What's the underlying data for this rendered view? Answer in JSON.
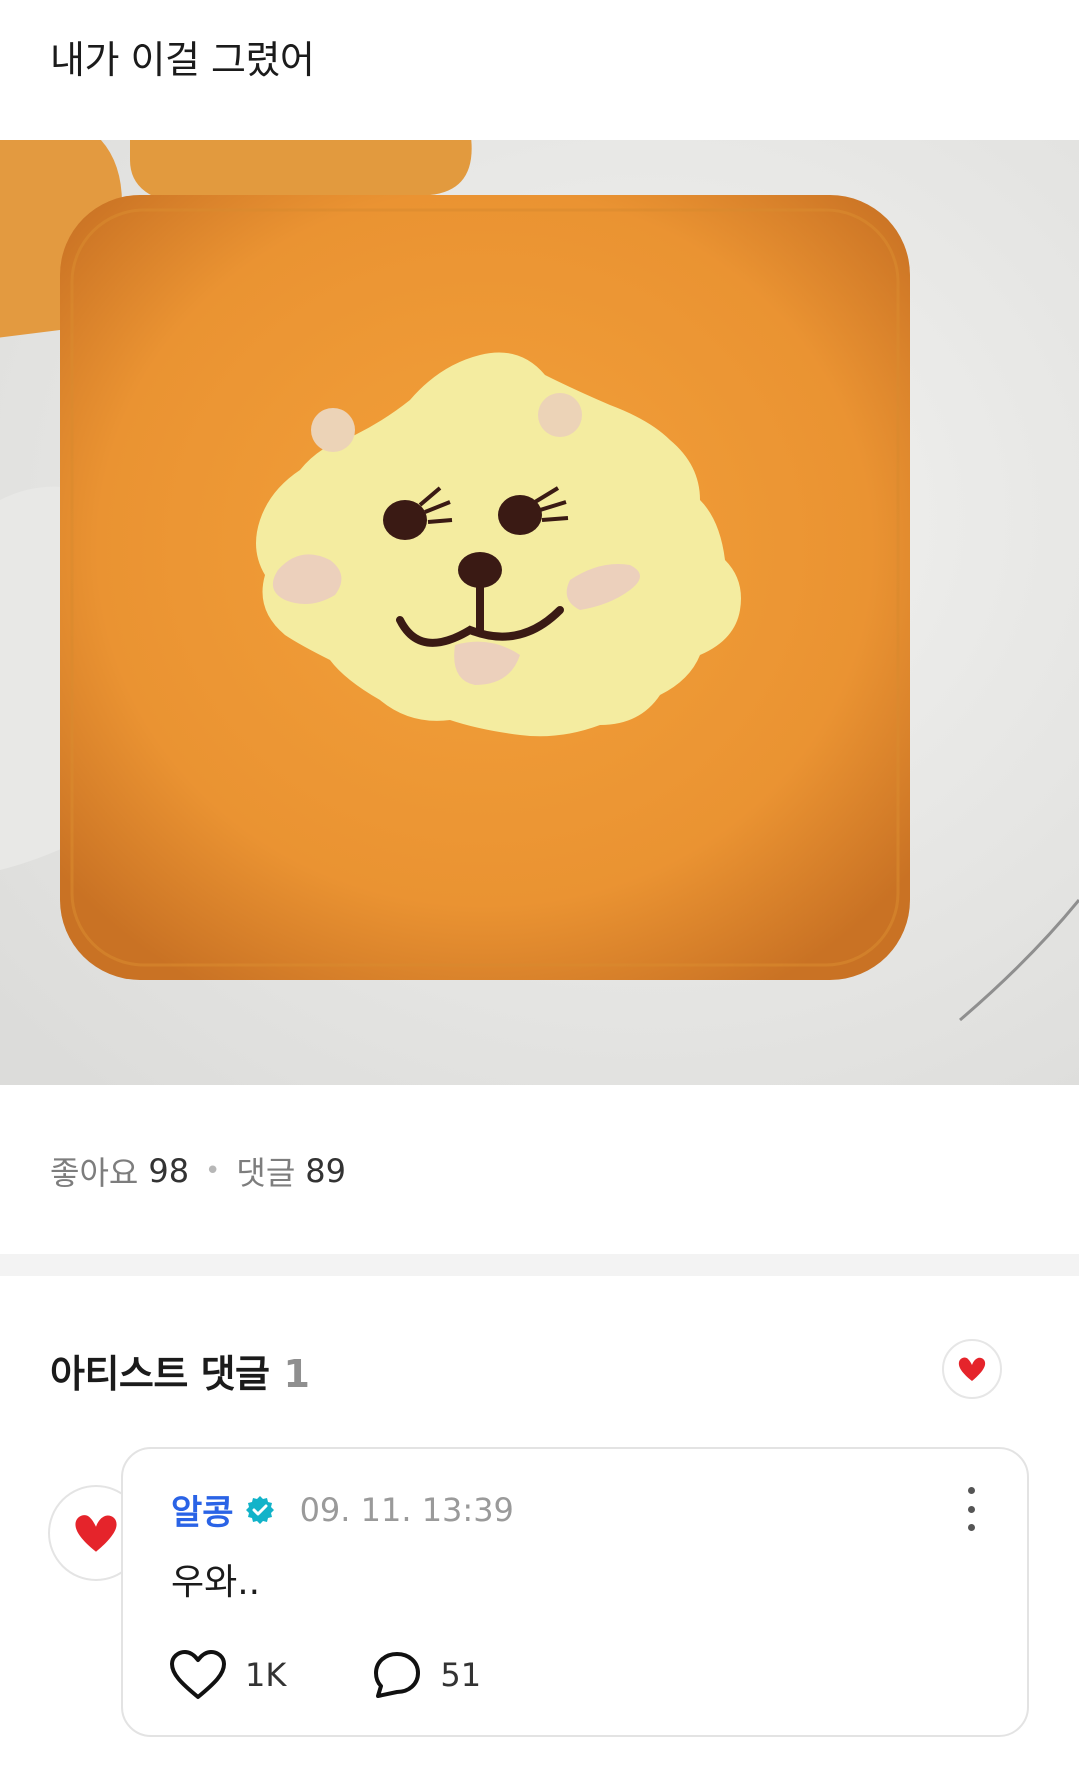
{
  "post": {
    "title": "내가 이걸 그렸어",
    "image_alt": "post-photo",
    "stats": {
      "likes_label": "좋아요",
      "likes_count": "98",
      "comments_label": "댓글",
      "comments_count": "89"
    }
  },
  "artist_comments": {
    "title": "아티스트 댓글",
    "count": "1",
    "badge_icon": "red-heart-icon"
  },
  "comment": {
    "author": "알콩",
    "verified_icon": "verified-badge-icon",
    "timestamp": "09. 11. 13:39",
    "text": "우와..",
    "likes": "1K",
    "replies": "51",
    "avatar_icon": "red-heart-icon",
    "more_icon": "more-vertical-icon"
  },
  "colors": {
    "accent_blue": "#2a63e6",
    "verified": "#12b3c9",
    "heart_red": "#e5242b"
  }
}
